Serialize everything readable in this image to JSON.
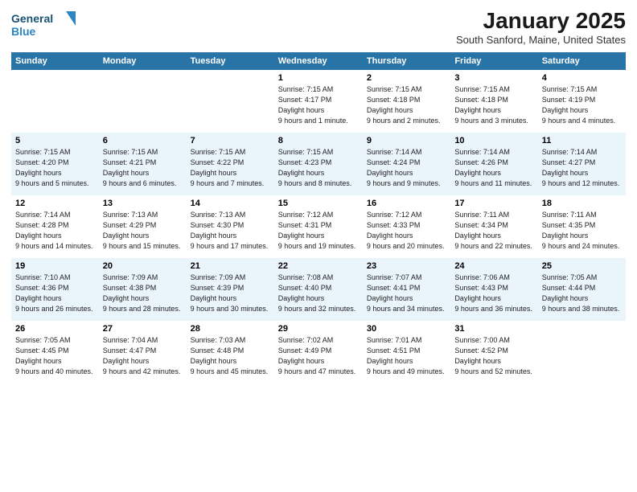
{
  "header": {
    "logo_line1": "General",
    "logo_line2": "Blue",
    "month_title": "January 2025",
    "location": "South Sanford, Maine, United States"
  },
  "days_of_week": [
    "Sunday",
    "Monday",
    "Tuesday",
    "Wednesday",
    "Thursday",
    "Friday",
    "Saturday"
  ],
  "weeks": [
    [
      {
        "day": "",
        "sunrise": "",
        "sunset": "",
        "daylight": ""
      },
      {
        "day": "",
        "sunrise": "",
        "sunset": "",
        "daylight": ""
      },
      {
        "day": "",
        "sunrise": "",
        "sunset": "",
        "daylight": ""
      },
      {
        "day": "1",
        "sunrise": "7:15 AM",
        "sunset": "4:17 PM",
        "daylight": "9 hours and 1 minute."
      },
      {
        "day": "2",
        "sunrise": "7:15 AM",
        "sunset": "4:18 PM",
        "daylight": "9 hours and 2 minutes."
      },
      {
        "day": "3",
        "sunrise": "7:15 AM",
        "sunset": "4:18 PM",
        "daylight": "9 hours and 3 minutes."
      },
      {
        "day": "4",
        "sunrise": "7:15 AM",
        "sunset": "4:19 PM",
        "daylight": "9 hours and 4 minutes."
      }
    ],
    [
      {
        "day": "5",
        "sunrise": "7:15 AM",
        "sunset": "4:20 PM",
        "daylight": "9 hours and 5 minutes."
      },
      {
        "day": "6",
        "sunrise": "7:15 AM",
        "sunset": "4:21 PM",
        "daylight": "9 hours and 6 minutes."
      },
      {
        "day": "7",
        "sunrise": "7:15 AM",
        "sunset": "4:22 PM",
        "daylight": "9 hours and 7 minutes."
      },
      {
        "day": "8",
        "sunrise": "7:15 AM",
        "sunset": "4:23 PM",
        "daylight": "9 hours and 8 minutes."
      },
      {
        "day": "9",
        "sunrise": "7:14 AM",
        "sunset": "4:24 PM",
        "daylight": "9 hours and 9 minutes."
      },
      {
        "day": "10",
        "sunrise": "7:14 AM",
        "sunset": "4:26 PM",
        "daylight": "9 hours and 11 minutes."
      },
      {
        "day": "11",
        "sunrise": "7:14 AM",
        "sunset": "4:27 PM",
        "daylight": "9 hours and 12 minutes."
      }
    ],
    [
      {
        "day": "12",
        "sunrise": "7:14 AM",
        "sunset": "4:28 PM",
        "daylight": "9 hours and 14 minutes."
      },
      {
        "day": "13",
        "sunrise": "7:13 AM",
        "sunset": "4:29 PM",
        "daylight": "9 hours and 15 minutes."
      },
      {
        "day": "14",
        "sunrise": "7:13 AM",
        "sunset": "4:30 PM",
        "daylight": "9 hours and 17 minutes."
      },
      {
        "day": "15",
        "sunrise": "7:12 AM",
        "sunset": "4:31 PM",
        "daylight": "9 hours and 19 minutes."
      },
      {
        "day": "16",
        "sunrise": "7:12 AM",
        "sunset": "4:33 PM",
        "daylight": "9 hours and 20 minutes."
      },
      {
        "day": "17",
        "sunrise": "7:11 AM",
        "sunset": "4:34 PM",
        "daylight": "9 hours and 22 minutes."
      },
      {
        "day": "18",
        "sunrise": "7:11 AM",
        "sunset": "4:35 PM",
        "daylight": "9 hours and 24 minutes."
      }
    ],
    [
      {
        "day": "19",
        "sunrise": "7:10 AM",
        "sunset": "4:36 PM",
        "daylight": "9 hours and 26 minutes."
      },
      {
        "day": "20",
        "sunrise": "7:09 AM",
        "sunset": "4:38 PM",
        "daylight": "9 hours and 28 minutes."
      },
      {
        "day": "21",
        "sunrise": "7:09 AM",
        "sunset": "4:39 PM",
        "daylight": "9 hours and 30 minutes."
      },
      {
        "day": "22",
        "sunrise": "7:08 AM",
        "sunset": "4:40 PM",
        "daylight": "9 hours and 32 minutes."
      },
      {
        "day": "23",
        "sunrise": "7:07 AM",
        "sunset": "4:41 PM",
        "daylight": "9 hours and 34 minutes."
      },
      {
        "day": "24",
        "sunrise": "7:06 AM",
        "sunset": "4:43 PM",
        "daylight": "9 hours and 36 minutes."
      },
      {
        "day": "25",
        "sunrise": "7:05 AM",
        "sunset": "4:44 PM",
        "daylight": "9 hours and 38 minutes."
      }
    ],
    [
      {
        "day": "26",
        "sunrise": "7:05 AM",
        "sunset": "4:45 PM",
        "daylight": "9 hours and 40 minutes."
      },
      {
        "day": "27",
        "sunrise": "7:04 AM",
        "sunset": "4:47 PM",
        "daylight": "9 hours and 42 minutes."
      },
      {
        "day": "28",
        "sunrise": "7:03 AM",
        "sunset": "4:48 PM",
        "daylight": "9 hours and 45 minutes."
      },
      {
        "day": "29",
        "sunrise": "7:02 AM",
        "sunset": "4:49 PM",
        "daylight": "9 hours and 47 minutes."
      },
      {
        "day": "30",
        "sunrise": "7:01 AM",
        "sunset": "4:51 PM",
        "daylight": "9 hours and 49 minutes."
      },
      {
        "day": "31",
        "sunrise": "7:00 AM",
        "sunset": "4:52 PM",
        "daylight": "9 hours and 52 minutes."
      },
      {
        "day": "",
        "sunrise": "",
        "sunset": "",
        "daylight": ""
      }
    ]
  ]
}
